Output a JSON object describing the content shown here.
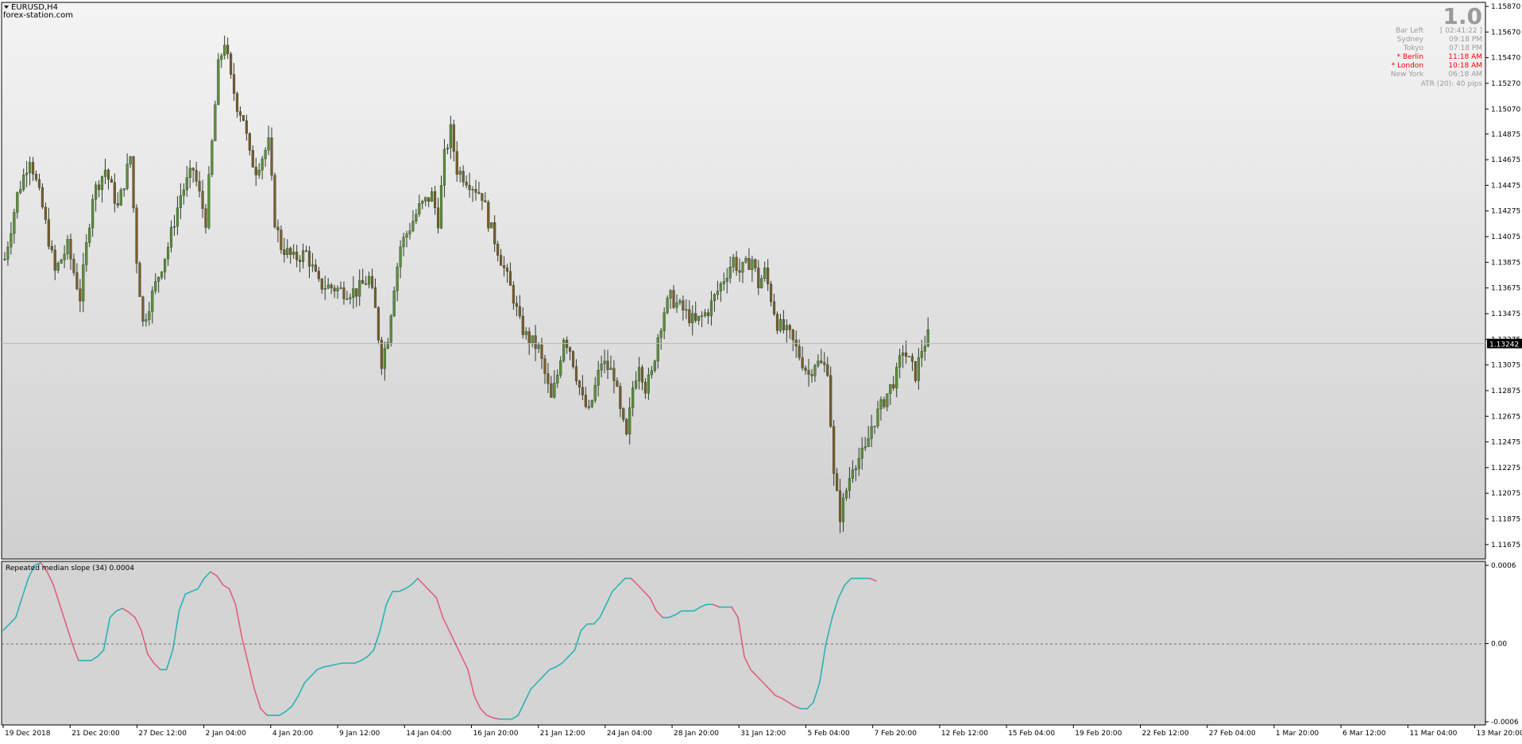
{
  "header": {
    "symbol": "EURUSD,H4",
    "site": "forex-station.com"
  },
  "info_panel": {
    "big_number": "1.0",
    "rows": [
      {
        "label": "Bar Left",
        "value": "[ 02:41:22 ]",
        "highlight": false
      },
      {
        "label": "Sydney",
        "value": "09:18 PM",
        "highlight": false
      },
      {
        "label": "Tokyo",
        "value": "07:18 PM",
        "highlight": false
      },
      {
        "label": "* Berlin",
        "value": "11:18 AM",
        "highlight": true
      },
      {
        "label": "* London",
        "value": "10:18 AM",
        "highlight": true
      },
      {
        "label": "New York",
        "value": "06:18 AM",
        "highlight": false
      }
    ],
    "atr_text": "ATR (20): 40 pips"
  },
  "colors": {
    "bull_body": "#5a8f3c",
    "bear_body": "#7a5c2e",
    "wick": "#2e3b24",
    "slope_up": "#2ab3b3",
    "slope_down": "#e0607e",
    "price_tag_bg": "#000000",
    "price_tag_text": "#ffffff",
    "highlight_text": "#ff0000",
    "info_text": "#9a9a9a"
  },
  "chart_data": [
    {
      "type": "candlestick",
      "symbol": "EURUSD",
      "timeframe": "H4",
      "ylim": [
        1.11575,
        1.1587
      ],
      "ytick_labels": [
        "1.15870",
        "1.15670",
        "1.15470",
        "1.15270",
        "1.15070",
        "1.14875",
        "1.14675",
        "1.14475",
        "1.14275",
        "1.14075",
        "1.13875",
        "1.13675",
        "1.13475",
        "1.13275",
        "1.13075",
        "1.12875",
        "1.12675",
        "1.12475",
        "1.12275",
        "1.12075",
        "1.11875",
        "1.11675"
      ],
      "current_price_label": "1.13242",
      "current_price": 1.13242,
      "x_tick_labels": [
        "19 Dec 2018",
        "21 Dec 20:00",
        "27 Dec 12:00",
        "2 Jan 04:00",
        "4 Jan 20:00",
        "9 Jan 12:00",
        "14 Jan 04:00",
        "16 Jan 20:00",
        "21 Jan 12:00",
        "24 Jan 04:00",
        "28 Jan 20:00",
        "31 Jan 12:00",
        "5 Feb 04:00",
        "7 Feb 20:00",
        "12 Feb 12:00",
        "15 Feb 04:00",
        "19 Feb 20:00",
        "22 Feb 12:00",
        "27 Feb 04:00",
        "1 Mar 20:00",
        "6 Mar 12:00",
        "11 Mar 04:00",
        "13 Mar 20:00"
      ],
      "close_path": [
        [
          0,
          1.139
        ],
        [
          4,
          1.144
        ],
        [
          8,
          1.147
        ],
        [
          12,
          1.143
        ],
        [
          16,
          1.138
        ],
        [
          20,
          1.14
        ],
        [
          24,
          1.136
        ],
        [
          28,
          1.144
        ],
        [
          32,
          1.146
        ],
        [
          36,
          1.143
        ],
        [
          40,
          1.147
        ],
        [
          42,
          1.139
        ],
        [
          44,
          1.134
        ],
        [
          48,
          1.137
        ],
        [
          52,
          1.14
        ],
        [
          56,
          1.144
        ],
        [
          60,
          1.146
        ],
        [
          64,
          1.142
        ],
        [
          66,
          1.148
        ],
        [
          68,
          1.154
        ],
        [
          70,
          1.156
        ],
        [
          72,
          1.153
        ],
        [
          74,
          1.151
        ],
        [
          76,
          1.15
        ],
        [
          78,
          1.147
        ],
        [
          80,
          1.146
        ],
        [
          84,
          1.148
        ],
        [
          86,
          1.142
        ],
        [
          88,
          1.14
        ],
        [
          92,
          1.139
        ],
        [
          96,
          1.1395
        ],
        [
          100,
          1.137
        ],
        [
          104,
          1.1368
        ],
        [
          108,
          1.1365
        ],
        [
          112,
          1.1365
        ],
        [
          116,
          1.1375
        ],
        [
          118,
          1.135
        ],
        [
          120,
          1.131
        ],
        [
          122,
          1.133
        ],
        [
          124,
          1.137
        ],
        [
          126,
          1.14
        ],
        [
          128,
          1.141
        ],
        [
          132,
          1.143
        ],
        [
          136,
          1.144
        ],
        [
          138,
          1.142
        ],
        [
          140,
          1.147
        ],
        [
          142,
          1.149
        ],
        [
          144,
          1.146
        ],
        [
          148,
          1.145
        ],
        [
          152,
          1.144
        ],
        [
          154,
          1.142
        ],
        [
          158,
          1.139
        ],
        [
          162,
          1.136
        ],
        [
          164,
          1.134
        ],
        [
          166,
          1.133
        ],
        [
          170,
          1.132
        ],
        [
          172,
          1.13
        ],
        [
          174,
          1.128
        ],
        [
          176,
          1.13
        ],
        [
          178,
          1.133
        ],
        [
          180,
          1.132
        ],
        [
          182,
          1.13
        ],
        [
          184,
          1.128
        ],
        [
          186,
          1.127
        ],
        [
          188,
          1.129
        ],
        [
          190,
          1.131
        ],
        [
          194,
          1.13
        ],
        [
          196,
          1.127
        ],
        [
          198,
          1.125
        ],
        [
          200,
          1.129
        ],
        [
          202,
          1.131
        ],
        [
          204,
          1.129
        ],
        [
          206,
          1.13
        ],
        [
          208,
          1.133
        ],
        [
          210,
          1.135
        ],
        [
          212,
          1.136
        ],
        [
          216,
          1.135
        ],
        [
          220,
          1.134
        ],
        [
          224,
          1.135
        ],
        [
          228,
          1.137
        ],
        [
          232,
          1.139
        ],
        [
          234,
          1.138
        ],
        [
          238,
          1.139
        ],
        [
          240,
          1.137
        ],
        [
          242,
          1.138
        ],
        [
          244,
          1.136
        ],
        [
          246,
          1.134
        ],
        [
          250,
          1.133
        ],
        [
          252,
          1.132
        ],
        [
          254,
          1.131
        ],
        [
          256,
          1.13
        ],
        [
          258,
          1.131
        ],
        [
          262,
          1.1305
        ],
        [
          264,
          1.122
        ],
        [
          266,
          1.119
        ],
        [
          268,
          1.121
        ],
        [
          270,
          1.123
        ],
        [
          274,
          1.124
        ],
        [
          276,
          1.126
        ],
        [
          280,
          1.128
        ],
        [
          282,
          1.129
        ],
        [
          284,
          1.13
        ],
        [
          286,
          1.132
        ],
        [
          288,
          1.131
        ],
        [
          290,
          1.13
        ],
        [
          292,
          1.132
        ],
        [
          294,
          1.133
        ]
      ]
    },
    {
      "type": "line",
      "title": "Repeated median slope (34) 0.0004",
      "ylim": [
        -0.0006,
        0.0006
      ],
      "ytick_labels": [
        "0.0006",
        "0.00",
        "-0.0006"
      ],
      "zero_line": true,
      "series": [
        {
          "x_index": [
            0,
            4,
            8,
            10,
            12,
            14,
            16,
            18,
            20,
            22,
            24,
            26,
            28,
            30,
            32,
            34,
            36,
            38,
            40,
            42,
            44,
            46,
            48,
            50,
            52,
            54,
            56,
            58,
            60,
            62,
            64,
            66,
            68,
            70,
            72,
            74,
            76,
            78,
            80,
            82,
            84,
            86,
            88,
            90,
            92,
            94,
            96,
            98,
            100,
            102,
            104,
            106,
            108,
            110,
            112,
            114,
            116,
            118,
            120,
            122,
            124,
            126,
            128,
            130,
            132,
            134,
            136,
            138,
            140,
            142,
            144,
            146,
            148,
            150,
            152,
            154,
            156,
            158,
            160,
            162,
            164,
            166,
            168,
            170,
            172,
            174,
            176,
            178,
            180,
            182,
            184,
            186,
            188,
            190,
            192,
            194,
            196,
            198,
            200,
            202,
            204,
            206,
            208,
            210,
            212,
            214,
            216,
            218,
            220,
            222,
            224,
            226,
            228,
            230,
            232,
            234,
            236,
            238,
            240,
            242,
            244,
            246,
            248,
            250,
            252,
            254,
            256,
            258,
            260,
            262,
            264,
            266,
            268,
            270,
            272,
            274,
            276,
            278,
            280,
            282,
            284,
            286,
            288,
            290,
            292,
            294
          ],
          "values": [
            0.0001,
            0.0002,
            0.0005,
            0.0006,
            0.00062,
            0.00055,
            0.00045,
            0.0003,
            0.00015,
            0.0,
            -0.00013,
            -0.00013,
            -0.00013,
            -0.0001,
            -5e-05,
            0.0002,
            0.00025,
            0.00027,
            0.00024,
            0.0002,
            0.0001,
            -8e-05,
            -0.00015,
            -0.0002,
            -0.0002,
            -5e-05,
            0.00025,
            0.00038,
            0.0004,
            0.00042,
            0.0005,
            0.00055,
            0.00052,
            0.00045,
            0.00042,
            0.0003,
            5e-05,
            -0.00015,
            -0.00035,
            -0.0005,
            -0.00055,
            -0.00055,
            -0.00055,
            -0.00052,
            -0.00048,
            -0.0004,
            -0.0003,
            -0.00025,
            -0.0002,
            -0.00018,
            -0.00017,
            -0.00016,
            -0.00015,
            -0.00015,
            -0.00015,
            -0.00013,
            -0.0001,
            -5e-05,
            0.0001,
            0.0003,
            0.0004,
            0.0004,
            0.00042,
            0.00045,
            0.0005,
            0.00045,
            0.0004,
            0.00035,
            0.0002,
            0.0001,
            0.0,
            -0.0001,
            -0.0002,
            -0.0004,
            -0.0005,
            -0.00055,
            -0.00057,
            -0.00058,
            -0.00058,
            -0.00058,
            -0.00055,
            -0.00045,
            -0.00035,
            -0.0003,
            -0.00025,
            -0.0002,
            -0.00018,
            -0.00015,
            -0.0001,
            -5e-05,
            0.0001,
            0.00015,
            0.00015,
            0.0002,
            0.0003,
            0.0004,
            0.00045,
            0.0005,
            0.0005,
            0.00045,
            0.0004,
            0.00035,
            0.00025,
            0.0002,
            0.0002,
            0.00022,
            0.00025,
            0.00025,
            0.00025,
            0.00028,
            0.0003,
            0.0003,
            0.00028,
            0.00028,
            0.00028,
            0.0002,
            -0.0001,
            -0.0002,
            -0.00025,
            -0.0003,
            -0.00035,
            -0.0004,
            -0.00042,
            -0.00045,
            -0.00048,
            -0.0005,
            -0.0005,
            -0.00045,
            -0.0003,
            0.0,
            0.0002,
            0.00035,
            0.00045,
            0.0005,
            0.0005,
            0.0005,
            0.0005,
            0.00048
          ]
        }
      ]
    }
  ]
}
